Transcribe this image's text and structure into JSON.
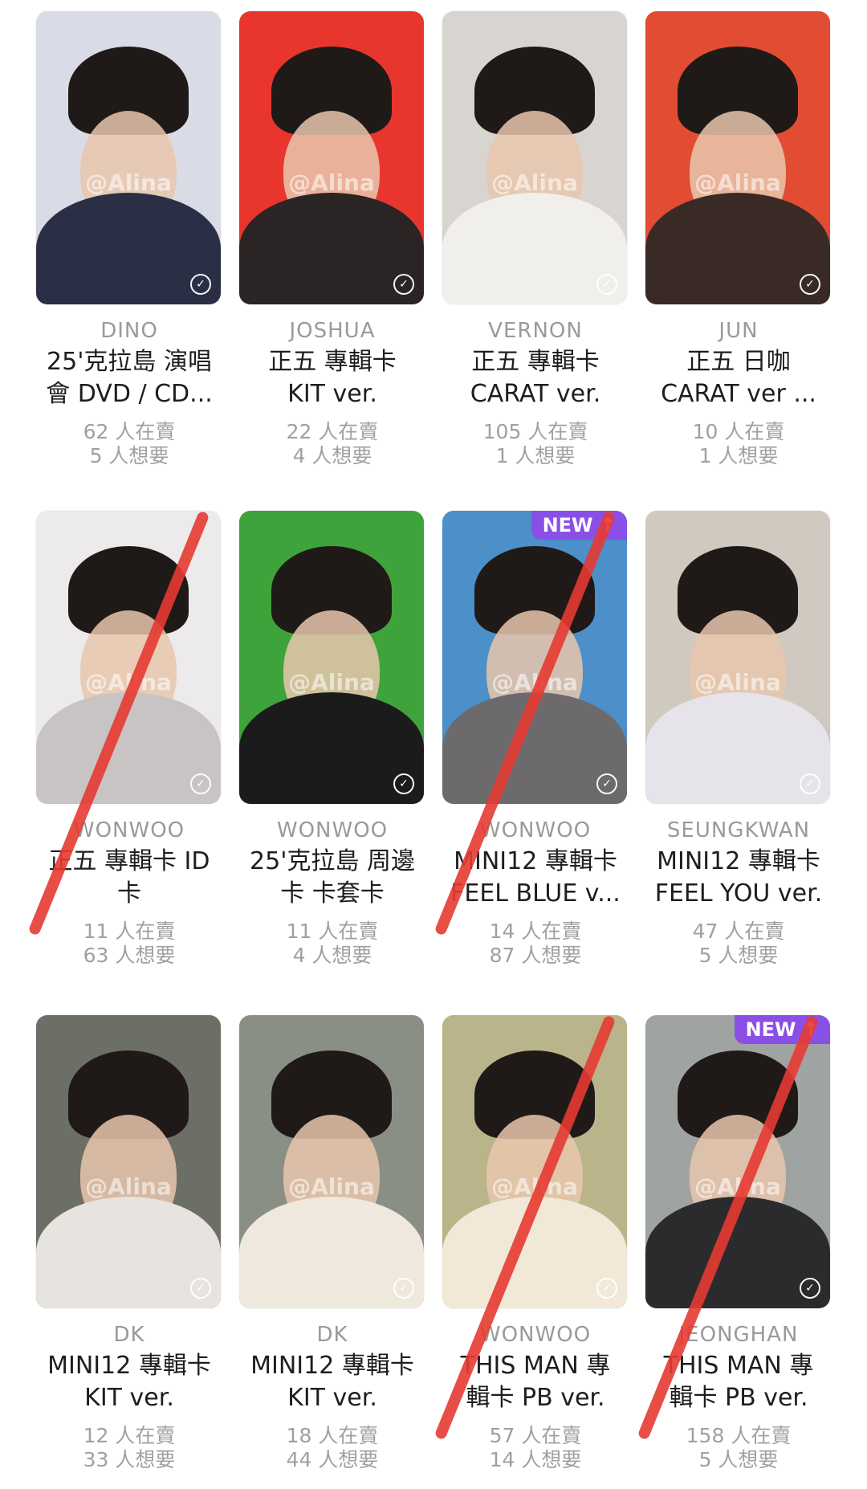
{
  "watermark": "@Alina",
  "check_icon": "check-circle-icon",
  "new_badge": "NEW ↑",
  "accent_color": "#8a4fe6",
  "strike_color": "#e53a32",
  "cards": [
    {
      "member": "DINO",
      "title": "25'克拉島 演唱\n會 DVD / CD...",
      "selling": "62 人在賣",
      "wanting": "5 人想要",
      "bg": "#d9dce6",
      "top": "#2a2f45"
    },
    {
      "member": "JOSHUA",
      "title": "正五 專輯卡\nKIT ver.",
      "selling": "22 人在賣",
      "wanting": "4 人想要",
      "bg": "#e8362e",
      "top": "#2b2424"
    },
    {
      "member": "VERNON",
      "title": "正五 專輯卡\nCARAT ver.",
      "selling": "105 人在賣",
      "wanting": "1 人想要",
      "bg": "#d8d4cf",
      "top": "#f1efec"
    },
    {
      "member": "JUN",
      "title": "正五 日咖\nCARAT ver ...",
      "selling": "10 人在賣",
      "wanting": "1 人想要",
      "bg": "#e24c32",
      "top": "#3a2a26"
    },
    {
      "member": "WONWOO",
      "title": "正五 專輯卡 ID\n卡",
      "selling": "11 人在賣",
      "wanting": "63 人想要",
      "bg": "#eceaea",
      "top": "#c8c4c4",
      "crossed": true
    },
    {
      "member": "WONWOO",
      "title": "25'克拉島 周邊\n卡 卡套卡",
      "selling": "11 人在賣",
      "wanting": "4 人想要",
      "bg": "#3fa33b",
      "top": "#1b1b1b"
    },
    {
      "member": "WONWOO",
      "title": "MINI12 專輯卡\nFEEL BLUE v...",
      "selling": "14 人在賣",
      "wanting": "87 人想要",
      "bg": "#4c8fc9",
      "top": "#6c6a6c",
      "new": true,
      "crossed": true
    },
    {
      "member": "SEUNGKWAN",
      "title": "MINI12 專輯卡\nFEEL YOU ver.",
      "selling": "47 人在賣",
      "wanting": "5 人想要",
      "bg": "#cfc9c0",
      "top": "#e6e3ea"
    },
    {
      "member": "DK",
      "title": "MINI12 專輯卡\nKIT ver.",
      "selling": "12 人在賣",
      "wanting": "33 人想要",
      "bg": "#6c6f66",
      "top": "#e7e4df"
    },
    {
      "member": "DK",
      "title": "MINI12 專輯卡\nKIT ver.",
      "selling": "18 人在賣",
      "wanting": "44 人想要",
      "bg": "#8a8f86",
      "top": "#efe8dc"
    },
    {
      "member": "WONWOO",
      "title": "THIS MAN 專\n輯卡 PB ver.",
      "selling": "57 人在賣",
      "wanting": "14 人想要",
      "bg": "#b9b48a",
      "top": "#f1e8d8",
      "crossed": true
    },
    {
      "member": "JEONGHAN",
      "title": "THIS MAN 專\n輯卡 PB ver.",
      "selling": "158 人在賣",
      "wanting": "5 人想要",
      "bg": "#9fa4a3",
      "top": "#2b2b2e",
      "new": true,
      "crossed": true
    }
  ]
}
